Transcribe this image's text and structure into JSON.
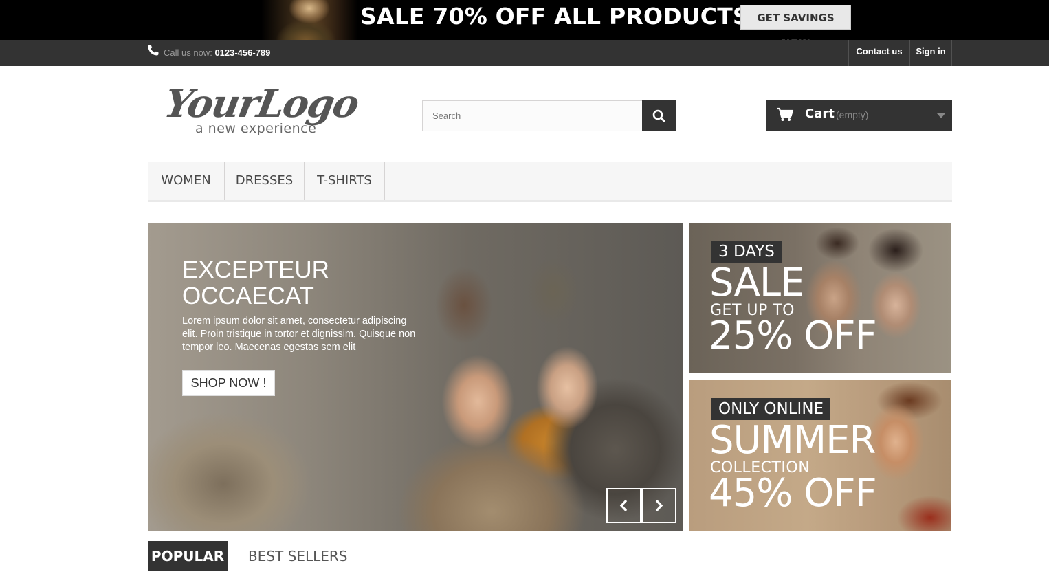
{
  "promo_banner": {
    "headline": "SALE 70% OFF ALL PRODUCTS",
    "button_label": "GET SAVINGS NOW"
  },
  "topbar": {
    "call_label": "Call us now:",
    "phone_number": "0123-456-789",
    "contact_label": "Contact us",
    "signin_label": "Sign in"
  },
  "logo": {
    "main_text": "YourLogo",
    "tagline": "a new experience"
  },
  "search": {
    "placeholder": "Search",
    "value": "",
    "button_icon": "search-icon"
  },
  "cart": {
    "label": "Cart",
    "status": "(empty)"
  },
  "menu": {
    "items": [
      "WOMEN",
      "DRESSES",
      "T-SHIRTS"
    ]
  },
  "slider": {
    "title": "EXCEPTEUR OCCAECAT",
    "body": "Lorem ipsum dolor sit amet, consectetur adipiscing elit. Proin tristique in tortor et dignissim. Quisque non tempor leo. Maecenas egestas sem elit",
    "cta_label": "SHOP NOW !"
  },
  "tiles": [
    {
      "tag": "3 DAYS",
      "headline": "SALE",
      "subline": "GET UP TO",
      "offer": "25% OFF"
    },
    {
      "tag": "ONLY ONLINE",
      "headline": "SUMMER",
      "subline": "COLLECTION",
      "offer": "45% OFF"
    }
  ],
  "tabs": {
    "popular": "POPULAR",
    "best_sellers": "BEST SELLERS"
  },
  "colors": {
    "dark": "#333333",
    "menu_bg": "#f6f6f6",
    "promo_bg": "#000000",
    "white": "#ffffff"
  }
}
